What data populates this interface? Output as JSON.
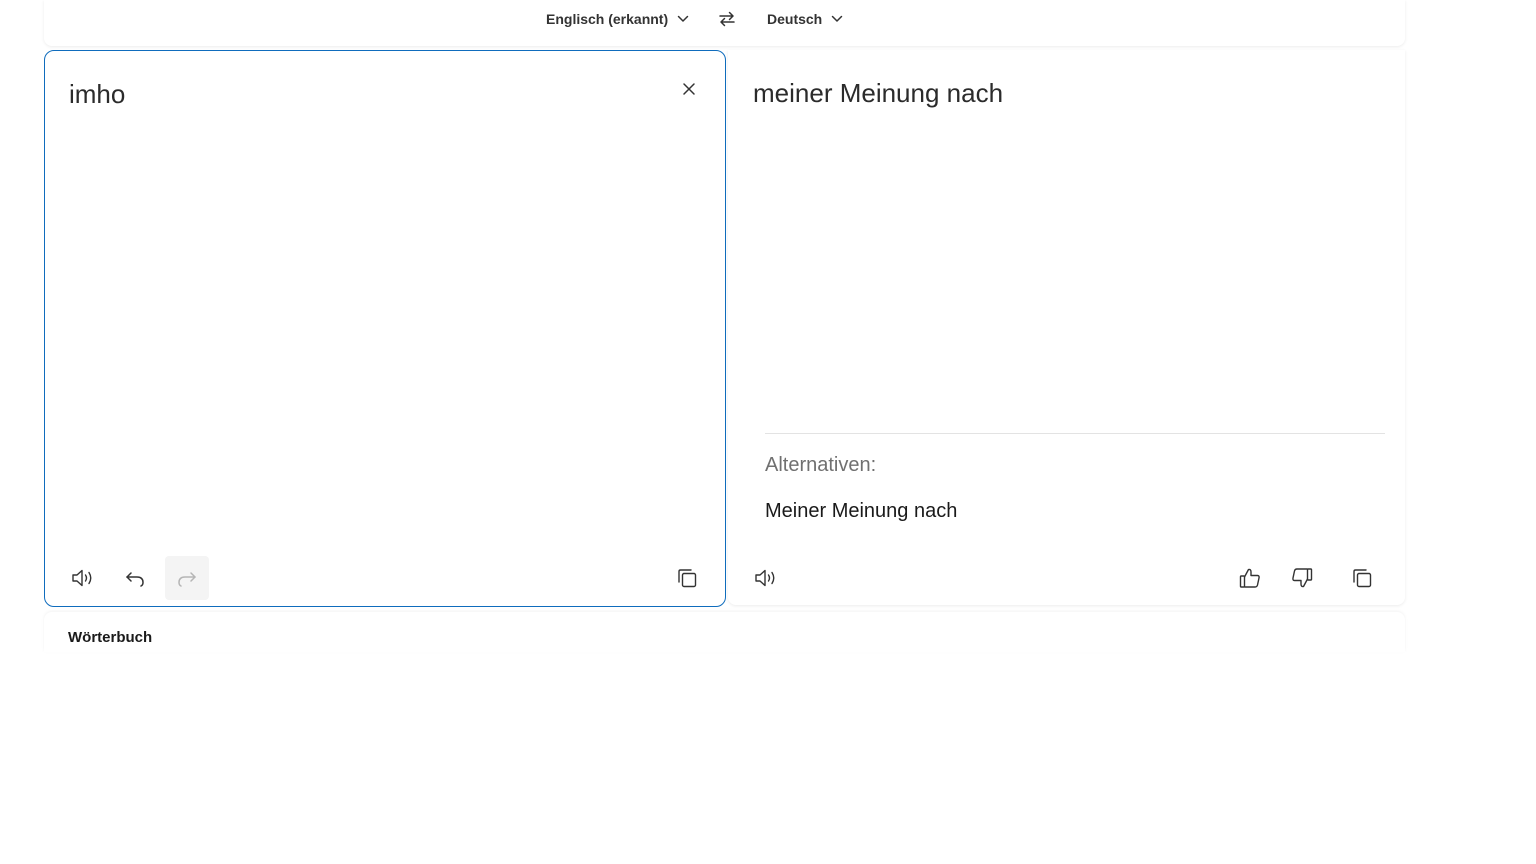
{
  "languages": {
    "source": "Englisch (erkannt)",
    "target": "Deutsch"
  },
  "source": {
    "text": "imho"
  },
  "target": {
    "text": "meiner Meinung nach",
    "alternatives_label": "Alternativen:",
    "alternatives": [
      "Meiner Meinung nach"
    ]
  },
  "dictionary": {
    "title": "Wörterbuch"
  },
  "icons": {
    "chevron": "chevron-down-icon",
    "swap": "swap-arrows-icon",
    "clear": "close-icon",
    "speaker": "speaker-icon",
    "undo": "undo-icon",
    "redo": "redo-icon",
    "copy": "copy-icon",
    "thumbs_up": "thumbs-up-icon",
    "thumbs_down": "thumbs-down-icon"
  },
  "colors": {
    "accent": "#0f6cbd",
    "text": "#1a1a1a",
    "muted": "#707070",
    "disabled_icon": "#b5b5b5"
  }
}
